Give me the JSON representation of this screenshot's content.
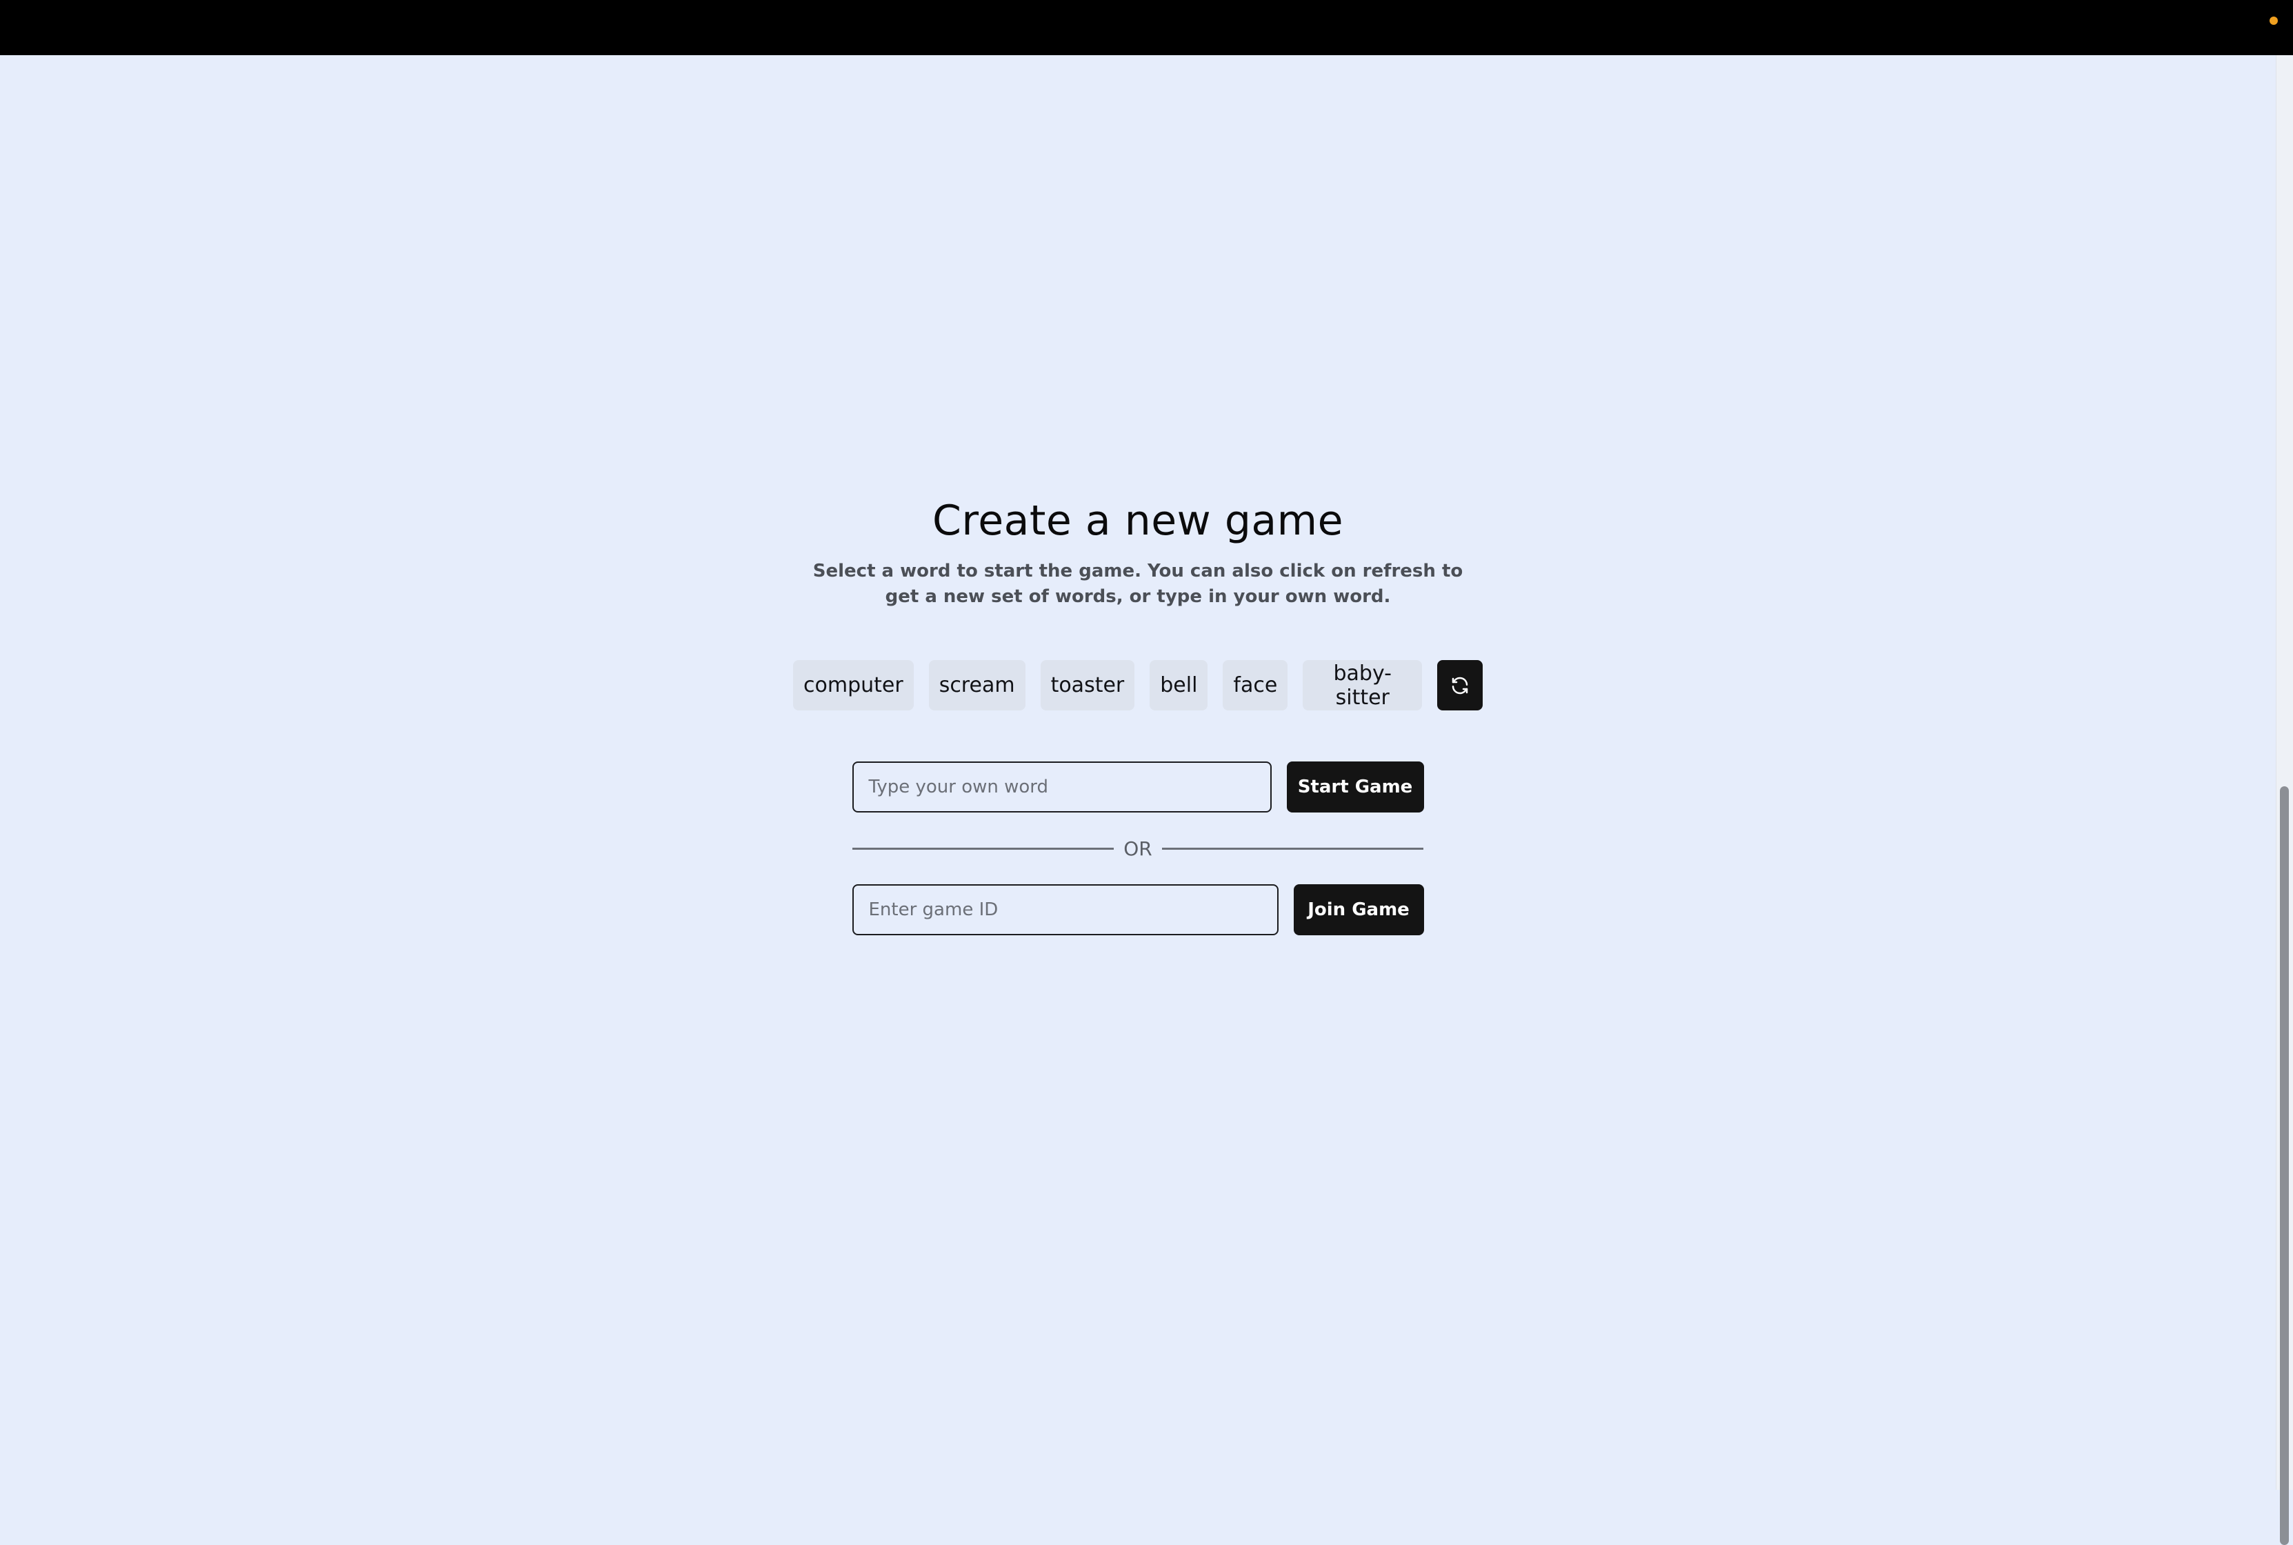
{
  "page": {
    "title": "Create a new game",
    "subtitle": "Select a word to start the game. You can also click on refresh to get a new set of words, or type in your own word."
  },
  "words": [
    "computer",
    "scream",
    "toaster",
    "bell",
    "face",
    "baby-sitter"
  ],
  "refresh": {
    "icon": "refresh-icon"
  },
  "custom_word": {
    "placeholder": "Type your own word",
    "button_label": "Start Game"
  },
  "divider": {
    "label": "OR"
  },
  "join": {
    "placeholder": "Enter game ID",
    "button_label": "Join Game"
  },
  "colors": {
    "background": "#e6edfb",
    "button": "#141414",
    "chip": "#dde3ee",
    "status_dot": "#f0a020"
  }
}
